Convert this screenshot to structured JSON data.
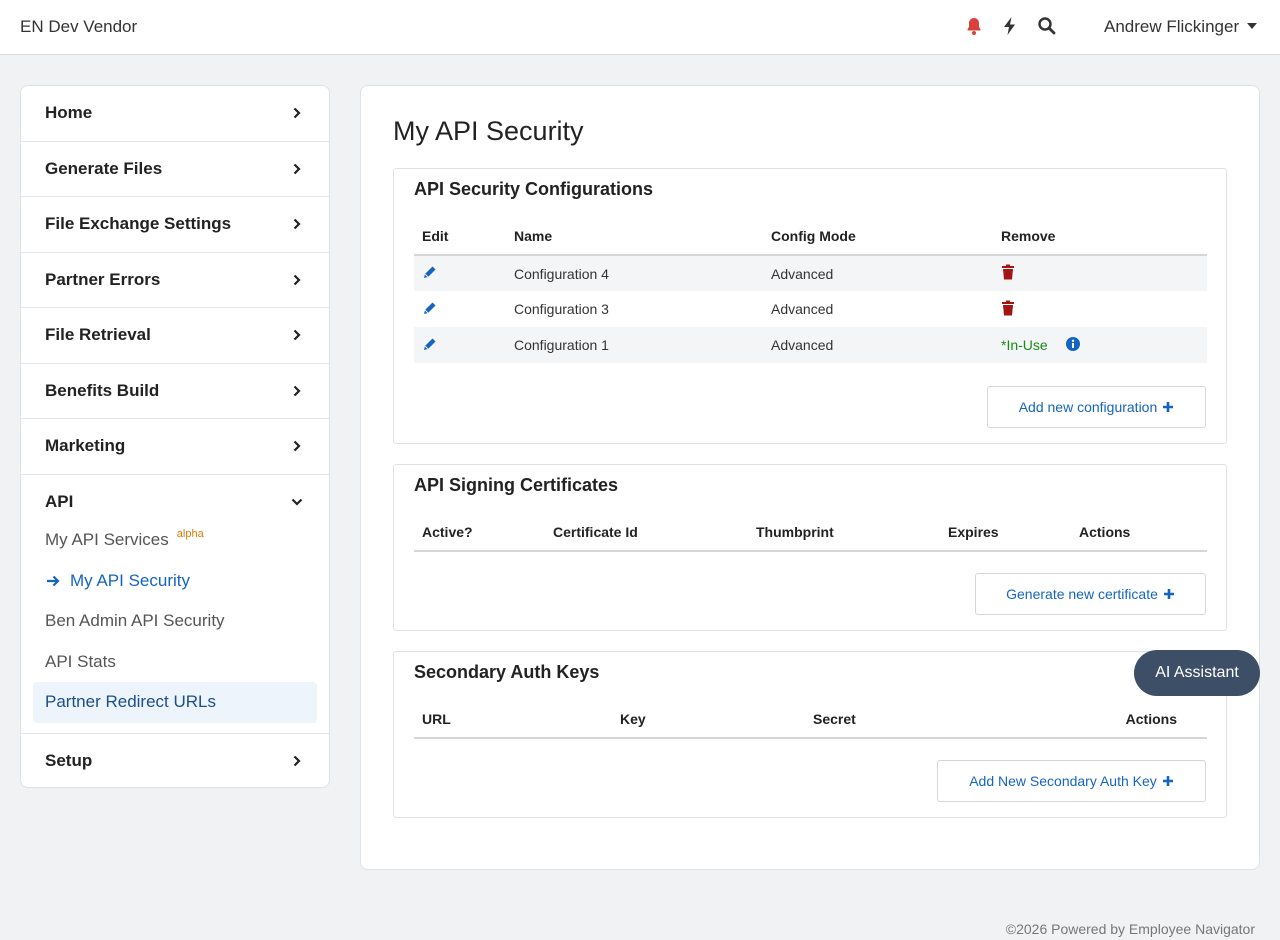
{
  "header": {
    "brand": "EN Dev Vendor",
    "user": "Andrew Flickinger",
    "icons": [
      "bell-icon",
      "bolt-icon",
      "search-icon"
    ],
    "bell_color": "#d9423a"
  },
  "sidebar": {
    "items": [
      {
        "label": "Home"
      },
      {
        "label": "Generate Files"
      },
      {
        "label": "File Exchange Settings"
      },
      {
        "label": "Partner Errors"
      },
      {
        "label": "File Retrieval"
      },
      {
        "label": "Benefits Build"
      },
      {
        "label": "Marketing"
      }
    ],
    "api": {
      "label": "API",
      "sub": {
        "services": "My API Services",
        "services_badge": "alpha",
        "security": "My API Security",
        "ben_admin": "Ben Admin API Security",
        "stats": "API Stats",
        "redirect": "Partner Redirect URLs"
      }
    },
    "setup": "Setup"
  },
  "main": {
    "title": "My API Security",
    "configs": {
      "title": "API Security Configurations",
      "columns": [
        "Edit",
        "Name",
        "Config Mode",
        "Remove"
      ],
      "rows": [
        {
          "name": "Configuration 4",
          "mode": "Advanced",
          "remove": "trash"
        },
        {
          "name": "Configuration 3",
          "mode": "Advanced",
          "remove": "trash"
        },
        {
          "name": "Configuration 1",
          "mode": "Advanced",
          "remove": "*In-Use"
        }
      ],
      "button": "Add new configuration"
    },
    "certs": {
      "title": "API Signing Certificates",
      "columns": [
        "Active?",
        "Certificate Id",
        "Thumbprint",
        "Expires",
        "Actions"
      ],
      "button": "Generate new certificate"
    },
    "keys": {
      "title": "Secondary Auth Keys",
      "columns": [
        "URL",
        "Key",
        "Secret",
        "Actions"
      ],
      "button": "Add New Secondary Auth Key"
    }
  },
  "ai_assistant": "AI Assistant",
  "footer": "©2026 Powered by Employee Navigator",
  "colors": {
    "accent": "#1565c0",
    "danger": "#a31515",
    "success": "#1a8a1a",
    "ai_button": "#3d4f66"
  }
}
